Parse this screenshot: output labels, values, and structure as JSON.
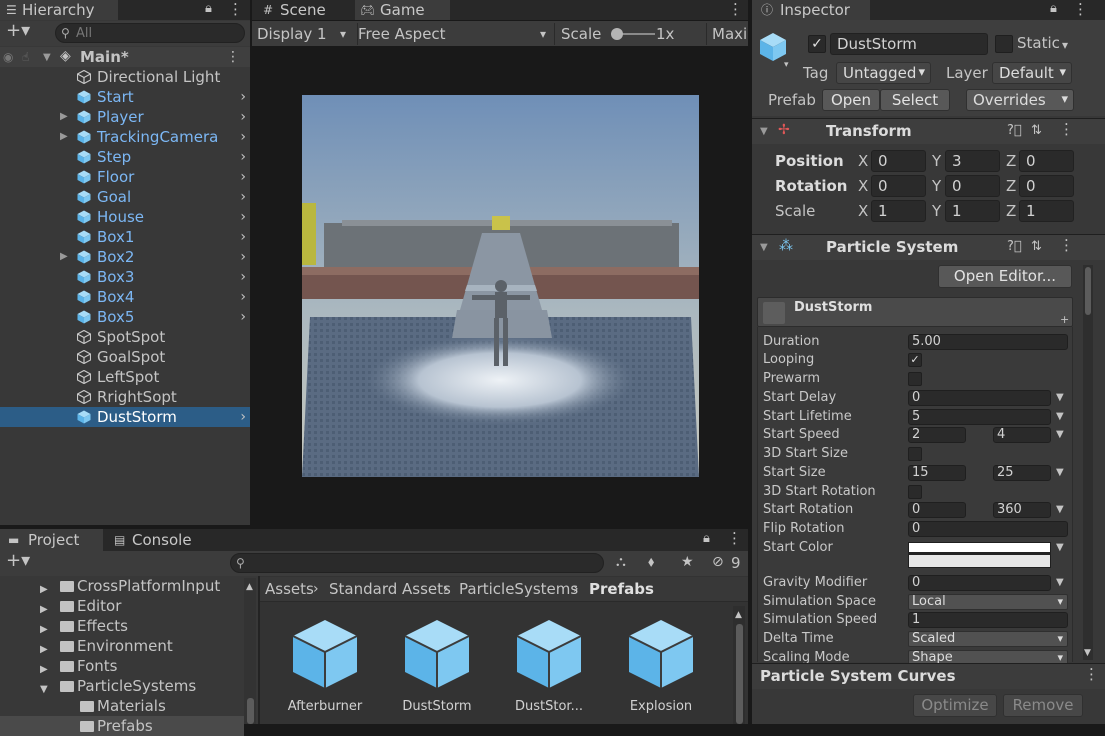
{
  "hierarchy": {
    "tab_label": "Hierarchy",
    "search_placeholder": "All",
    "scene_name": "Main*",
    "items": [
      {
        "label": "Directional Light",
        "prefab": false,
        "expandable": false,
        "children_arrow": false
      },
      {
        "label": "Start",
        "prefab": true,
        "expandable": false,
        "children_arrow": true
      },
      {
        "label": "Player",
        "prefab": true,
        "expandable": true,
        "children_arrow": true
      },
      {
        "label": "TrackingCamera",
        "prefab": true,
        "expandable": true,
        "children_arrow": true
      },
      {
        "label": "Step",
        "prefab": true,
        "expandable": false,
        "children_arrow": true
      },
      {
        "label": "Floor",
        "prefab": true,
        "expandable": false,
        "children_arrow": true
      },
      {
        "label": "Goal",
        "prefab": true,
        "expandable": false,
        "children_arrow": true
      },
      {
        "label": "House",
        "prefab": true,
        "expandable": false,
        "children_arrow": true
      },
      {
        "label": "Box1",
        "prefab": true,
        "expandable": false,
        "children_arrow": true
      },
      {
        "label": "Box2",
        "prefab": true,
        "expandable": true,
        "children_arrow": true
      },
      {
        "label": "Box3",
        "prefab": true,
        "expandable": false,
        "children_arrow": true
      },
      {
        "label": "Box4",
        "prefab": true,
        "expandable": false,
        "children_arrow": true
      },
      {
        "label": "Box5",
        "prefab": true,
        "expandable": false,
        "children_arrow": true
      },
      {
        "label": "SpotSpot",
        "prefab": false,
        "expandable": false,
        "children_arrow": false
      },
      {
        "label": "GoalSpot",
        "prefab": false,
        "expandable": false,
        "children_arrow": false
      },
      {
        "label": "LeftSpot",
        "prefab": false,
        "expandable": false,
        "children_arrow": false
      },
      {
        "label": "RrightSopt",
        "prefab": false,
        "expandable": false,
        "children_arrow": false
      },
      {
        "label": "DustStorm",
        "prefab": true,
        "expandable": false,
        "children_arrow": true,
        "selected": true
      }
    ]
  },
  "game": {
    "tab_scene": "Scene",
    "tab_game": "Game",
    "display": "Display 1",
    "aspect": "Free Aspect",
    "scale_label": "Scale",
    "scale_value": "1x",
    "maxi_label": "Maxi"
  },
  "inspector": {
    "tab_label": "Inspector",
    "object_name": "DustStorm",
    "static_label": "Static",
    "tag_label": "Tag",
    "tag_value": "Untagged",
    "layer_label": "Layer",
    "layer_value": "Default",
    "prefab_label": "Prefab",
    "open_btn": "Open",
    "select_btn": "Select",
    "overrides_btn": "Overrides",
    "transform": {
      "title": "Transform",
      "position_label": "Position",
      "rotation_label": "Rotation",
      "scale_label": "Scale",
      "x": "X",
      "y": "Y",
      "z": "Z",
      "position": [
        "0",
        "3",
        "0"
      ],
      "rotation": [
        "0",
        "0",
        "0"
      ],
      "scale": [
        "1",
        "1",
        "1"
      ]
    },
    "particle": {
      "title": "Particle System",
      "open_editor": "Open Editor...",
      "module_name": "DustStorm",
      "duration_label": "Duration",
      "duration": "5.00",
      "looping_label": "Looping",
      "prewarm_label": "Prewarm",
      "start_delay_label": "Start Delay",
      "start_delay": "0",
      "start_lifetime_label": "Start Lifetime",
      "start_lifetime": "5",
      "start_speed_label": "Start Speed",
      "start_speed_min": "2",
      "start_speed_max": "4",
      "start_size_3d_label": "3D Start Size",
      "start_size_label": "Start Size",
      "start_size_min": "15",
      "start_size_max": "25",
      "start_rotation_3d_label": "3D Start Rotation",
      "start_rotation_label": "Start Rotation",
      "start_rotation_min": "0",
      "start_rotation_max": "360",
      "flip_rotation_label": "Flip Rotation",
      "flip_rotation": "0",
      "start_color_label": "Start Color",
      "gravity_label": "Gravity Modifier",
      "gravity": "0",
      "sim_space_label": "Simulation Space",
      "sim_space": "Local",
      "sim_speed_label": "Simulation Speed",
      "sim_speed": "1",
      "delta_time_label": "Delta Time",
      "delta_time": "Scaled",
      "scaling_mode_label": "Scaling Mode",
      "scaling_mode": "Shape"
    },
    "curves_label": "Particle System Curves",
    "optimize_btn": "Optimize",
    "remove_btn": "Remove"
  },
  "project": {
    "tab_project": "Project",
    "tab_console": "Console",
    "hidden_count": "9",
    "folders": [
      {
        "label": "CrossPlatformInput",
        "open": false
      },
      {
        "label": "Editor",
        "open": false
      },
      {
        "label": "Effects",
        "open": false
      },
      {
        "label": "Environment",
        "open": false
      },
      {
        "label": "Fonts",
        "open": false
      },
      {
        "label": "ParticleSystems",
        "open": true
      },
      {
        "label": "Materials",
        "open": false,
        "child": true
      },
      {
        "label": "Prefabs",
        "open": false,
        "child": true
      }
    ],
    "breadcrumb": [
      "Assets",
      "Standard Assets",
      "ParticleSystems",
      "Prefabs"
    ],
    "assets": [
      "Afterburner",
      "DustStorm",
      "DustStor...",
      "Explosion"
    ]
  }
}
